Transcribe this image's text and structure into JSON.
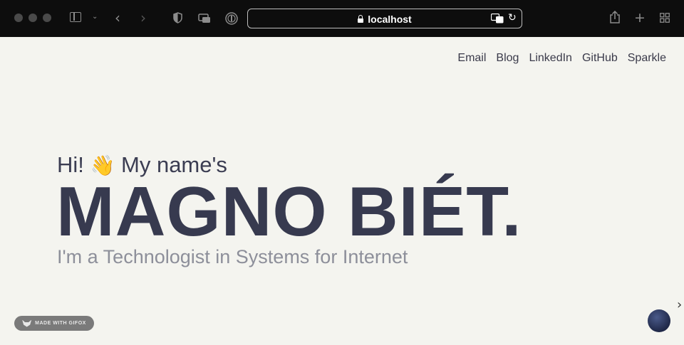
{
  "browser": {
    "address": "localhost",
    "icons": [
      "sidebar-icon",
      "chevron-down-icon",
      "back-icon",
      "forward-icon",
      "shield-icon",
      "tabs-icon",
      "password-icon",
      "translate-icon",
      "reload-icon",
      "share-icon",
      "new-tab-icon",
      "tab-overview-icon"
    ]
  },
  "nav": {
    "links": [
      "Email",
      "Blog",
      "LinkedIn",
      "GitHub",
      "Sparkle"
    ]
  },
  "hero": {
    "greeting_pre": "Hi!",
    "greeting_emoji": "👋",
    "greeting_post": "My name's",
    "name": "MAGNO BIÉT.",
    "tagline": "I'm a Technologist in Systems for Internet"
  },
  "badge": {
    "label": "MADE WITH GIFOX"
  },
  "colors": {
    "background": "#f4f4ef",
    "heading": "#373a4f",
    "tagline": "#8d8f9a",
    "chrome": "#0d0d0d"
  }
}
